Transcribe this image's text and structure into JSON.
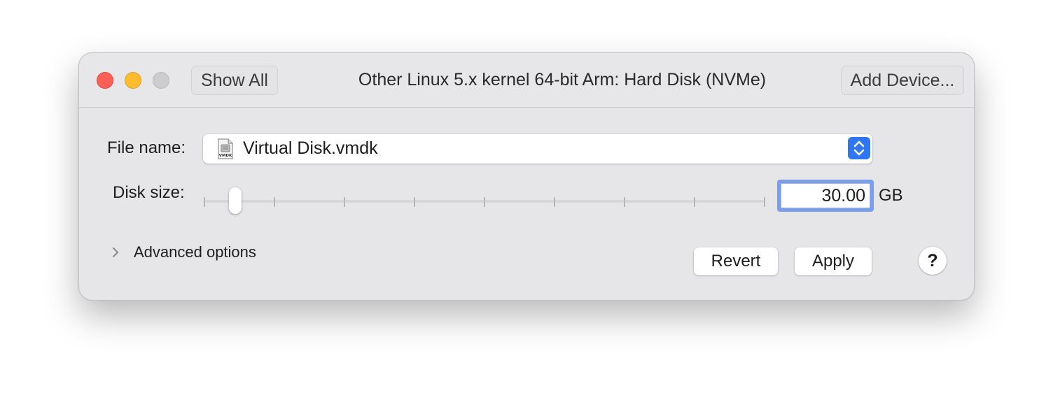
{
  "window": {
    "title": "Other Linux 5.x kernel 64-bit Arm: Hard Disk (NVMe)"
  },
  "toolbar": {
    "show_all_label": "Show All",
    "add_device_label": "Add Device..."
  },
  "file": {
    "label": "File name:",
    "value": "Virtual Disk.vmdk",
    "icon": "vmdk-file-icon",
    "icon_text": "VMDK"
  },
  "disk": {
    "label": "Disk size:",
    "value": "30.00",
    "unit": "GB",
    "slider_tick_count": 9,
    "slider_position": 0.047
  },
  "advanced": {
    "label": "Advanced options",
    "expanded": false
  },
  "actions": {
    "revert_label": "Revert",
    "apply_label": "Apply",
    "help_label": "?"
  },
  "colors": {
    "close": "#fe5f57",
    "minimize": "#febc2e",
    "zoom_inactive": "#cdcccf",
    "accent": "#2e76f2",
    "focus_ring": "#7a9ee8"
  }
}
